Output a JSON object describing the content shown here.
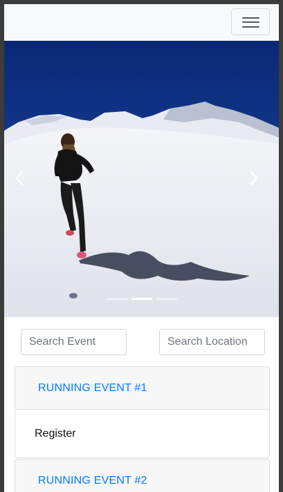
{
  "navbar": {
    "toggler_icon": "hamburger-icon"
  },
  "carousel": {
    "prev_icon": "chevron-left-icon",
    "next_icon": "chevron-right-icon",
    "indicator_count": 3,
    "active_slide": 1
  },
  "search": {
    "event_placeholder": "Search Event",
    "location_placeholder": "Search Location"
  },
  "events": [
    {
      "title": "RUNNING EVENT #1",
      "action": "Register"
    },
    {
      "title": "RUNNING EVENT #2"
    }
  ],
  "colors": {
    "link": "#007bff",
    "navbar_bg": "#f8f9fa",
    "sky": "#0d2f8a"
  }
}
